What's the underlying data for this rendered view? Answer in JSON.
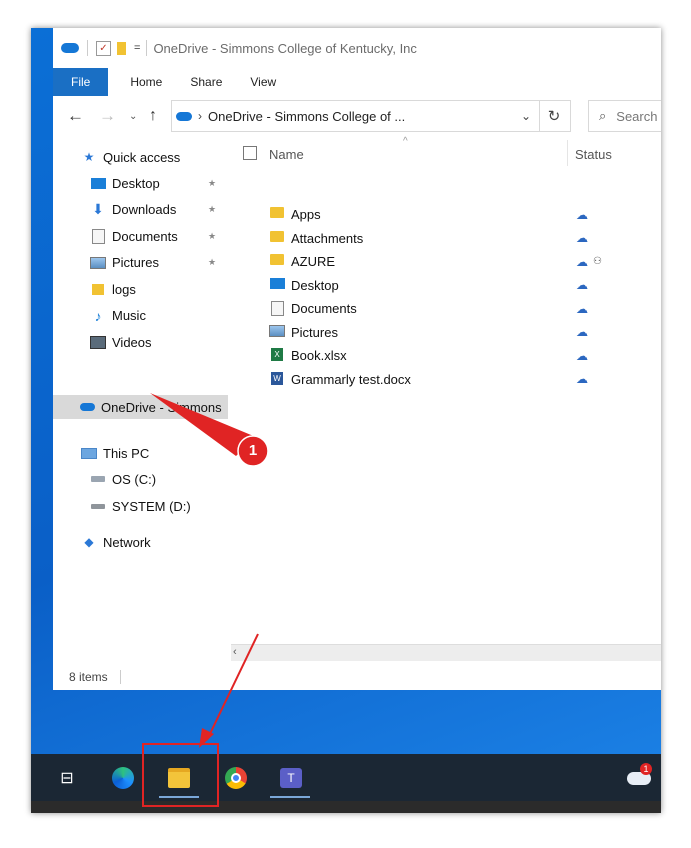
{
  "titlebar": {
    "path_title": "OneDrive - Simmons College of Kentucky, Inc",
    "dropdown_glyph": "="
  },
  "ribbon": {
    "file": "File",
    "home": "Home",
    "share": "Share",
    "view": "View"
  },
  "address": {
    "path": "OneDrive - Simmons College of ...",
    "search_placeholder": "Search OneDri"
  },
  "nav": {
    "quick_access": "Quick access",
    "items": [
      {
        "label": "Desktop",
        "icon": "desktop-icon",
        "pinned": true
      },
      {
        "label": "Downloads",
        "icon": "download-icon",
        "pinned": true
      },
      {
        "label": "Documents",
        "icon": "documents-icon",
        "pinned": true
      },
      {
        "label": "Pictures",
        "icon": "pictures-icon",
        "pinned": true
      },
      {
        "label": "logs",
        "icon": "folder-icon",
        "pinned": false
      },
      {
        "label": "Music",
        "icon": "music-icon",
        "pinned": false
      },
      {
        "label": "Videos",
        "icon": "videos-icon",
        "pinned": false
      }
    ],
    "onedrive": "OneDrive - Simmons",
    "this_pc": "This PC",
    "drives": [
      {
        "label": "OS (C:)"
      },
      {
        "label": "SYSTEM (D:)"
      }
    ],
    "network": "Network"
  },
  "list": {
    "col_name": "Name",
    "col_status": "Status",
    "files": [
      {
        "name": "Apps",
        "type": "folder",
        "status_extra": ""
      },
      {
        "name": "Attachments",
        "type": "folder",
        "status_extra": ""
      },
      {
        "name": "AZURE",
        "type": "folder",
        "status_extra": "shared"
      },
      {
        "name": "Desktop",
        "type": "desktop",
        "status_extra": ""
      },
      {
        "name": "Documents",
        "type": "documents",
        "status_extra": ""
      },
      {
        "name": "Pictures",
        "type": "pictures",
        "status_extra": ""
      },
      {
        "name": "Book.xlsx",
        "type": "excel",
        "status_extra": ""
      },
      {
        "name": "Grammarly test.docx",
        "type": "word",
        "status_extra": ""
      }
    ]
  },
  "statusbar": {
    "items": "8 items"
  },
  "annotation": {
    "step": "1",
    "colors": {
      "callout": "#e02424",
      "highlight_box": "#e02424"
    }
  },
  "taskbar": {
    "apps": [
      "task-view-icon",
      "edge-icon",
      "file-explorer-icon",
      "chrome-icon",
      "teams-icon"
    ],
    "tray_badge": "1"
  }
}
